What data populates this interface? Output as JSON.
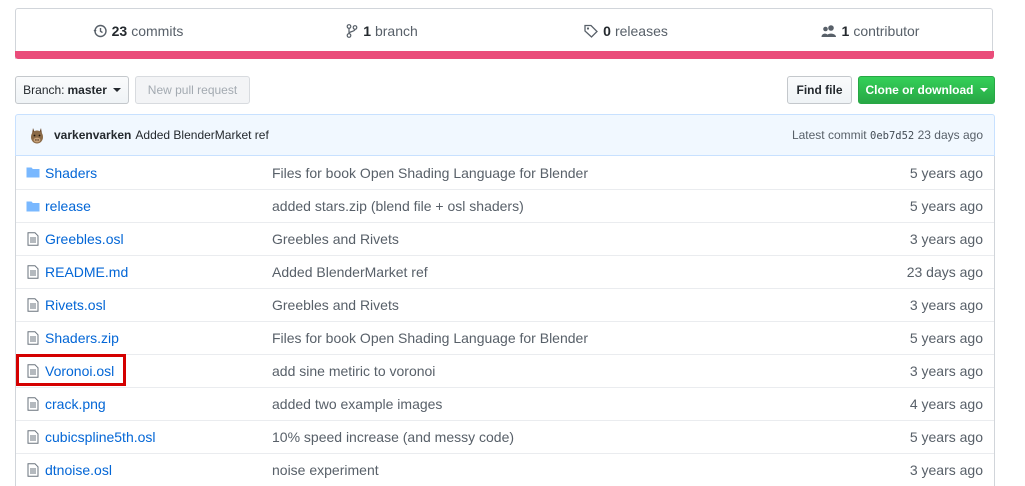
{
  "stats": {
    "commits_num": "23",
    "commits_label": "commits",
    "branch_num": "1",
    "branch_label": "branch",
    "releases_num": "0",
    "releases_label": "releases",
    "contributor_num": "1",
    "contributor_label": "contributor"
  },
  "language_bar_color": "#ea4c7a",
  "toolbar": {
    "branch_prefix": "Branch:",
    "branch_name": "master",
    "new_pr_label": "New pull request",
    "find_file_label": "Find file",
    "clone_label": "Clone or download"
  },
  "commit": {
    "author": "varkenvarken",
    "message": "Added BlenderMarket ref",
    "latest_label": "Latest commit",
    "sha": "0eb7d52",
    "age": "23 days ago"
  },
  "files": [
    {
      "name": "Shaders",
      "type": "dir",
      "message": "Files for book Open Shading Language for Blender",
      "age": "5 years ago"
    },
    {
      "name": "release",
      "type": "dir",
      "message": "added stars.zip (blend file + osl shaders)",
      "age": "5 years ago"
    },
    {
      "name": "Greebles.osl",
      "type": "file",
      "message": "Greebles and Rivets",
      "age": "3 years ago"
    },
    {
      "name": "README.md",
      "type": "file",
      "message": "Added BlenderMarket ref",
      "age": "23 days ago"
    },
    {
      "name": "Rivets.osl",
      "type": "file",
      "message": "Greebles and Rivets",
      "age": "3 years ago"
    },
    {
      "name": "Shaders.zip",
      "type": "file",
      "message": "Files for book Open Shading Language for Blender",
      "age": "5 years ago"
    },
    {
      "name": "Voronoi.osl",
      "type": "file",
      "message": "add sine metiric to voronoi",
      "age": "3 years ago"
    },
    {
      "name": "crack.png",
      "type": "file",
      "message": "added two example images",
      "age": "4 years ago"
    },
    {
      "name": "cubicspline5th.osl",
      "type": "file",
      "message": "10% speed increase (and messy code)",
      "age": "5 years ago"
    },
    {
      "name": "dtnoise.osl",
      "type": "file",
      "message": "noise experiment",
      "age": "3 years ago"
    }
  ],
  "highlight_color": "#d40000"
}
